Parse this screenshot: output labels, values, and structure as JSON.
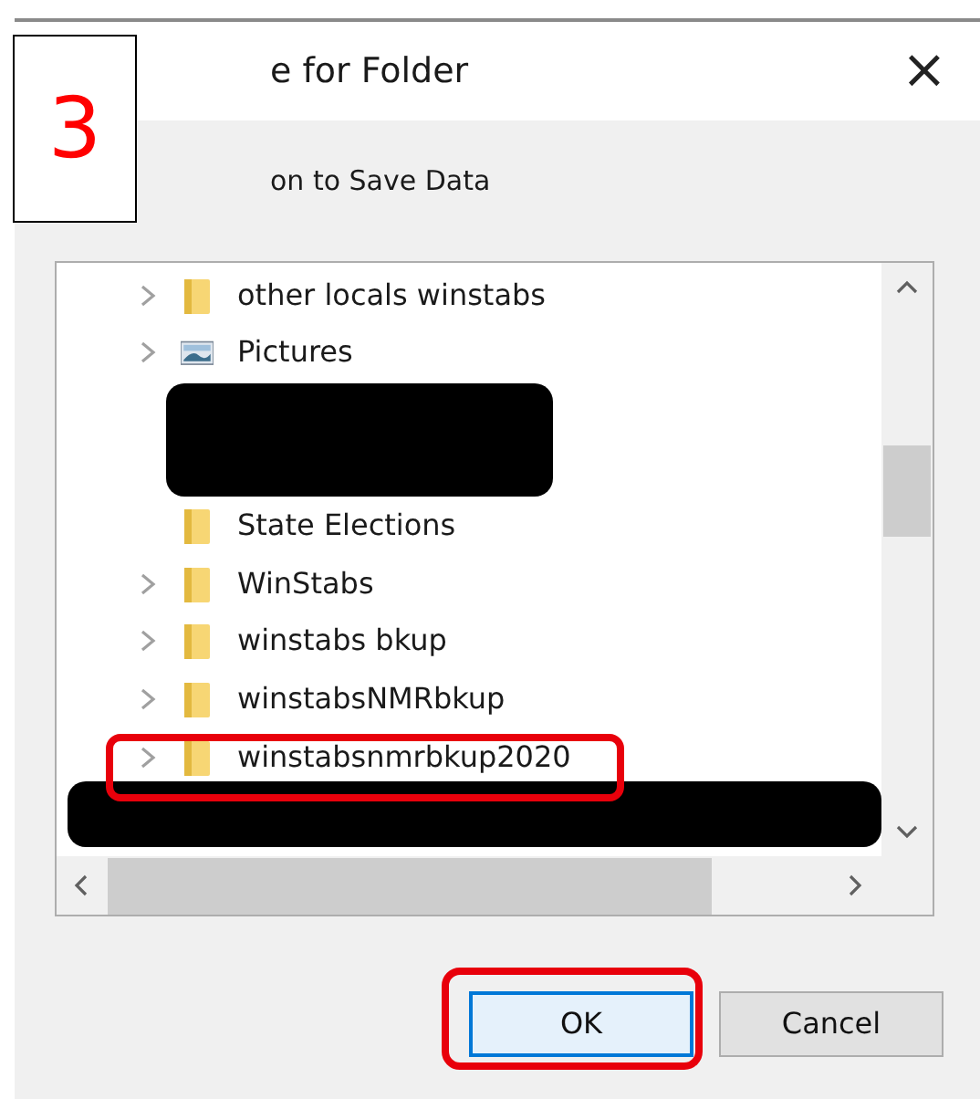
{
  "step_label": "3",
  "window": {
    "title": "e for Folder",
    "close": "×"
  },
  "prompt": "on to Save Data",
  "tree": {
    "rows": [
      {
        "kind": "folder",
        "label": "other locals winstabs",
        "expandable": true,
        "highlighted": false
      },
      {
        "kind": "pictures",
        "label": "Pictures",
        "expandable": true,
        "highlighted": false
      },
      {
        "kind": "redacted_block"
      },
      {
        "kind": "folder",
        "label": "State Elections",
        "expandable": false,
        "highlighted": false
      },
      {
        "kind": "folder",
        "label": "WinStabs",
        "expandable": true,
        "highlighted": false
      },
      {
        "kind": "folder",
        "label": "winstabs bkup",
        "expandable": true,
        "highlighted": false
      },
      {
        "kind": "folder",
        "label": "winstabsNMRbkup",
        "expandable": true,
        "highlighted": false
      },
      {
        "kind": "folder",
        "label": "winstabsnmrbkup2020",
        "expandable": true,
        "highlighted": true
      },
      {
        "kind": "redacted_bar"
      }
    ]
  },
  "buttons": [
    {
      "label": "OK",
      "default": true,
      "highlighted": true
    },
    {
      "label": "Cancel",
      "default": false,
      "highlighted": false
    }
  ]
}
